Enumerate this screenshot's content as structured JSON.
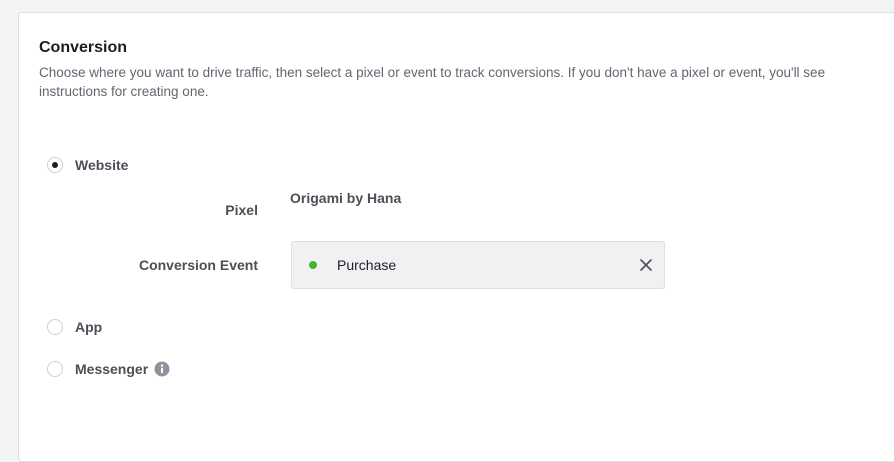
{
  "section": {
    "title": "Conversion",
    "description": "Choose where you want to drive traffic, then select a pixel or event to track conversions. If you don't have a pixel or event, you'll see instructions for creating one."
  },
  "destinations": [
    {
      "label": "Website",
      "selected": true
    },
    {
      "label": "App",
      "selected": false
    },
    {
      "label": "Messenger",
      "selected": false,
      "icon": "info-icon"
    }
  ],
  "pixel": {
    "label": "Pixel",
    "value": "Origami by Hana"
  },
  "conversion_event": {
    "label": "Conversion Event",
    "value": "Purchase",
    "status_color": "#42b72a",
    "clear_icon": "close-icon"
  }
}
